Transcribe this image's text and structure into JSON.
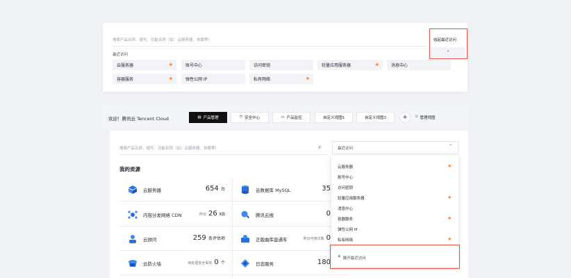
{
  "top_panel": {
    "search_placeholder": "搜索产品名称、缩写、功能名称（如：云服务器、休眠等）",
    "recent_label": "最近访问",
    "pin_button_label": "收起最近访问",
    "collapse_arrow": "⌃",
    "chips": [
      {
        "label": "云服务器",
        "starred": true
      },
      {
        "label": "账号中心",
        "starred": false
      },
      {
        "label": "访问密钥",
        "starred": false
      },
      {
        "label": "轻量应用服务器",
        "starred": true
      },
      {
        "label": "消息中心",
        "starred": false
      },
      {
        "label": "容器服务",
        "starred": true
      },
      {
        "label": "弹性公网 IP",
        "starred": false
      },
      {
        "label": "私有网络",
        "starred": true
      }
    ]
  },
  "header": {
    "welcome": "欢迎！腾讯云 Tencent Cloud",
    "tabs": [
      {
        "label": "产品管理",
        "icon": "file-icon",
        "active": true
      },
      {
        "label": "安全中心",
        "icon": "shield-icon",
        "active": false
      },
      {
        "label": "产品监控",
        "icon": "monitor-icon",
        "active": false
      },
      {
        "label": "自定义视图5",
        "icon": "",
        "active": false
      },
      {
        "label": "自定义视图3",
        "icon": "",
        "active": false
      }
    ],
    "add_label": "+",
    "manage_label": "管理视图"
  },
  "main": {
    "search_placeholder": "搜索产品名称、缩写、功能名称（如：云服务器、休眠等）",
    "recent_select_label": "最近访问",
    "my_resources_title": "我的资源",
    "resources_left": [
      {
        "name": "云服务器",
        "sub": "",
        "value": "654",
        "unit": "台",
        "icon": "cvm-icon"
      },
      {
        "name": "内容分发网络 CDN",
        "sub": "昨日",
        "value": "26",
        "unit": "KB",
        "icon": "cdn-icon"
      },
      {
        "name": "云顾问",
        "sub": "",
        "value": "259",
        "unit": "条评估项",
        "icon": "advisor-icon"
      },
      {
        "name": "云防火墙",
        "sub": "待处理安全事件",
        "value": "0",
        "unit": "个",
        "icon": "firewall-icon"
      }
    ],
    "resources_right": [
      {
        "name": "云数据库 MySQL",
        "sub": "",
        "value": "35",
        "icon": "mysql-icon"
      },
      {
        "name": "腾讯云搜",
        "sub": "",
        "value": "0",
        "icon": "search-service-icon"
      },
      {
        "name": "正版曲库直通车",
        "sub": "昨日可用次数",
        "value": "0",
        "icon": "music-icon"
      },
      {
        "name": "日志服务",
        "sub": "",
        "value": "180",
        "icon": "log-icon"
      }
    ]
  },
  "dropdown": {
    "items": [
      {
        "label": "云服务器",
        "starred": true
      },
      {
        "label": "账号中心",
        "starred": false
      },
      {
        "label": "访问密钥",
        "starred": false
      },
      {
        "label": "轻量应用服务器",
        "starred": true
      },
      {
        "label": "消息中心",
        "starred": false
      },
      {
        "label": "容器服务",
        "starred": true
      },
      {
        "label": "弹性公网 IP",
        "starred": false
      },
      {
        "label": "私有网络",
        "starred": true
      }
    ],
    "expand_label": "展开最近访问",
    "expand_icon": "≚"
  },
  "colors": {
    "star": "#ff7a1f",
    "highlight": "#e8544a",
    "active_tab": "#111111"
  }
}
